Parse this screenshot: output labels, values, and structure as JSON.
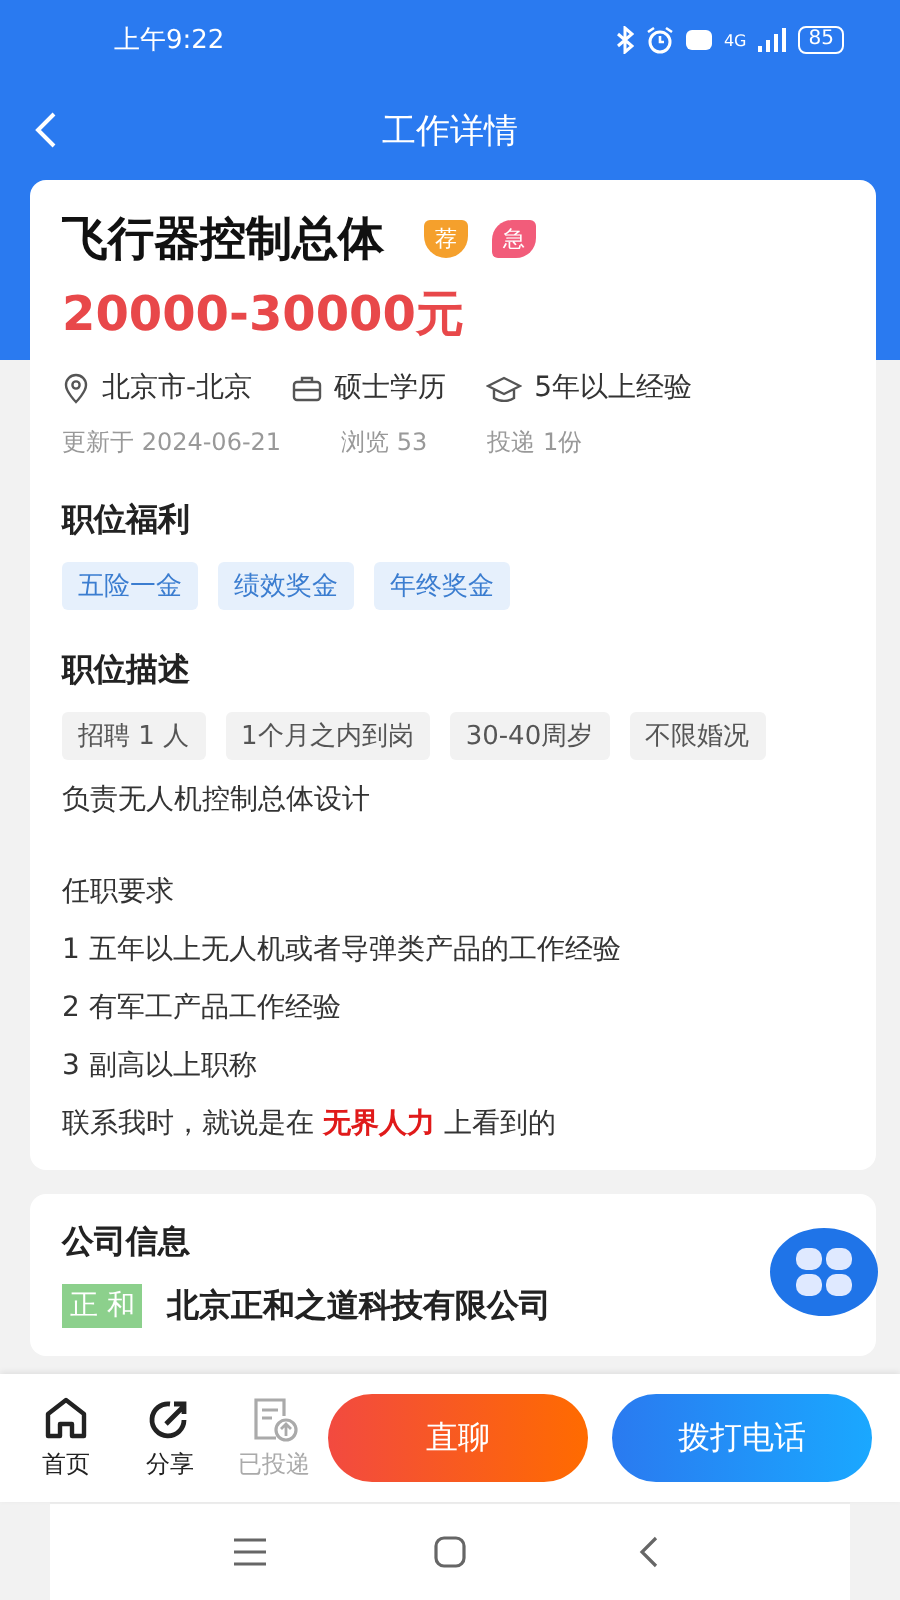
{
  "status_bar": {
    "time": "上午9:22",
    "battery": "85",
    "network": "4G"
  },
  "header": {
    "title": "工作详情"
  },
  "job": {
    "title": "飞行器控制总体",
    "badges": [
      {
        "label": "荐",
        "kind": "shield"
      },
      {
        "label": "急",
        "kind": "leaf"
      }
    ],
    "salary": "20000-30000元",
    "facts": [
      {
        "kind": "location",
        "text": "北京市-北京"
      },
      {
        "kind": "education",
        "text": "硕士学历"
      },
      {
        "kind": "experience",
        "text": "5年以上经验"
      }
    ],
    "meta": [
      "更新于 2024-06-21",
      "浏览 53",
      "投递 1份"
    ]
  },
  "benefits": {
    "title": "职位福利",
    "tags": [
      "五险一金",
      "绩效奖金",
      "年终奖金"
    ]
  },
  "description": {
    "title": "职位描述",
    "tags": [
      "招聘 1 人",
      "1个月之内到岗",
      "30-40周岁",
      "不限婚况"
    ],
    "paragraphs": [
      "负责无人机控制总体设计",
      "任职要求",
      "1 五年以上无人机或者导弹类产品的工作经验",
      "2 有军工产品工作经验",
      "3 副高以上职称",
      "联系我时，就说是在 **无界人力** 上看到的"
    ]
  },
  "company": {
    "title": "公司信息",
    "logo": "正 和",
    "name": "北京正和之道科技有限公司"
  },
  "bottom_bar": {
    "items": [
      {
        "kind": "home",
        "label": "首页",
        "disabled": false
      },
      {
        "kind": "share",
        "label": "分享",
        "disabled": false
      },
      {
        "kind": "applied",
        "label": "已投递",
        "disabled": true
      }
    ],
    "buttons": [
      {
        "kind": "chat",
        "label": "直聊"
      },
      {
        "kind": "call",
        "label": "拨打电话"
      }
    ]
  }
}
